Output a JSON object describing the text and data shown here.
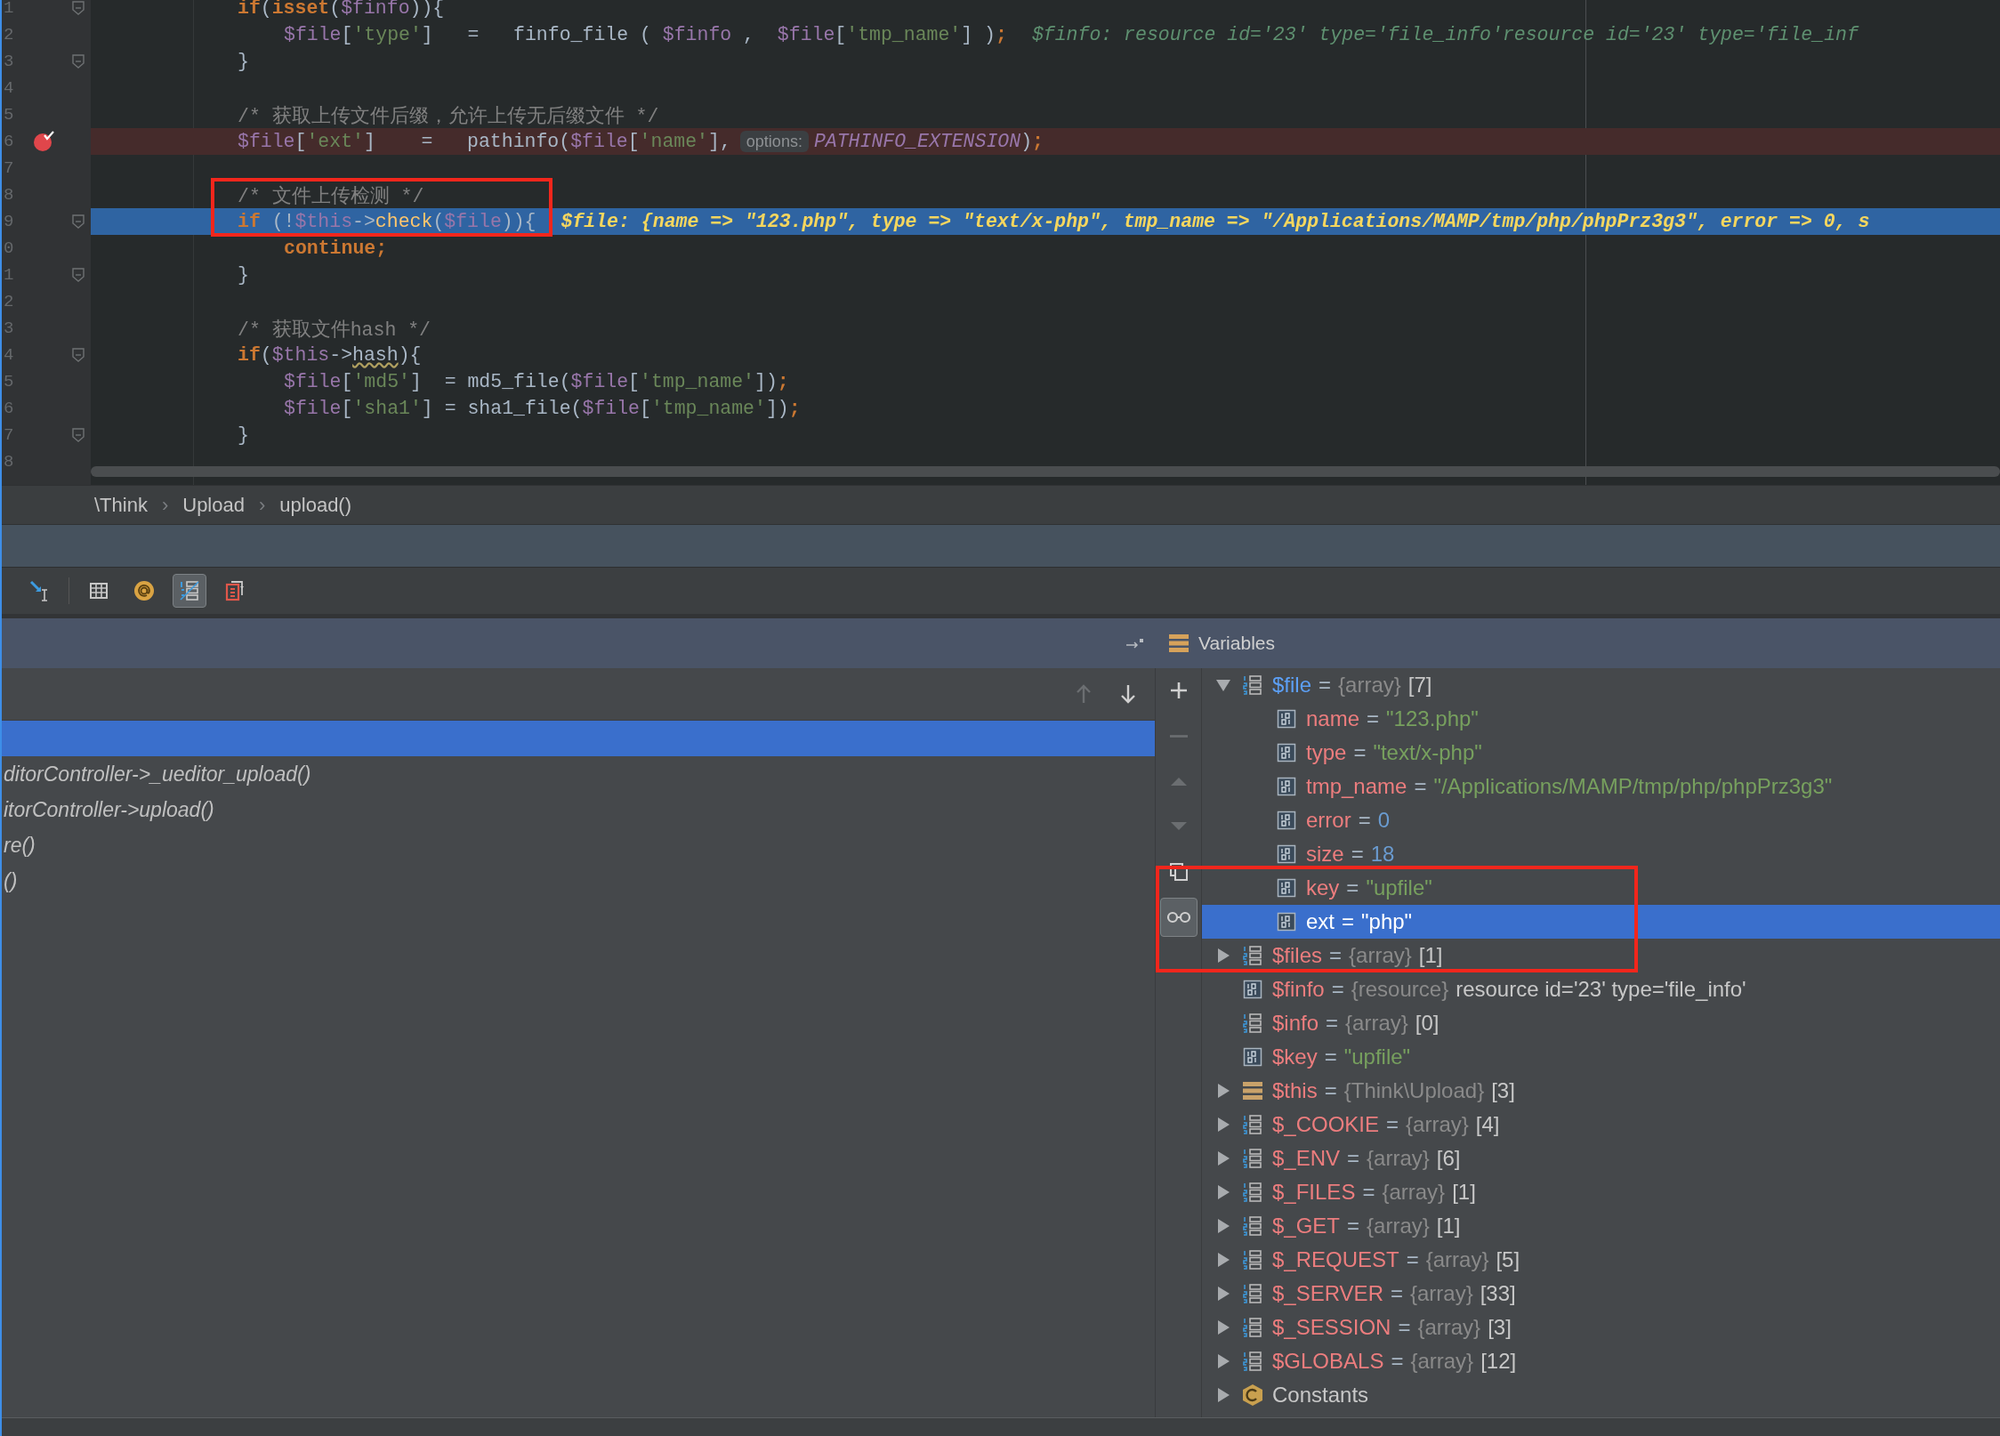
{
  "editor": {
    "lines": [
      {
        "number": "1",
        "kind": "normal",
        "fold": true,
        "segments": [
          {
            "kind": "code",
            "tokens": [
              {
                "kind": "kw",
                "text": "if"
              },
              {
                "kind": "plain",
                "text": "("
              },
              {
                "kind": "kw",
                "text": "isset"
              },
              {
                "kind": "plain",
                "text": "("
              },
              {
                "kind": "var",
                "text": "$finfo"
              },
              {
                "kind": "plain",
                "text": ")){"
              }
            ]
          }
        ],
        "children": [
          {
            "number": "2",
            "fold": false,
            "segments": [
              {
                "kind": "code",
                "tokens": [
                  {
                    "kind": "var",
                    "text": "$file"
                  },
                  {
                    "kind": "plain",
                    "text": "["
                  },
                  {
                    "kind": "str",
                    "text": "'type'"
                  },
                  {
                    "kind": "plain",
                    "text": "]   =   finfo_file ( "
                  },
                  {
                    "kind": "var",
                    "text": "$finfo"
                  },
                  {
                    "kind": "plain",
                    "text": " ,  "
                  },
                  {
                    "kind": "var",
                    "text": "$file"
                  },
                  {
                    "kind": "plain",
                    "text": "["
                  },
                  {
                    "kind": "str",
                    "text": "'tmp_name'"
                  },
                  {
                    "kind": "plain",
                    "text": "] )"
                  },
                  {
                    "kind": "kw",
                    "text": ";"
                  }
                ]
              },
              {
                "kind": "value-hint",
                "text": "$finfo: resource id='23' type='file_info'resource id='23' type='file_inf"
              }
            ]
          }
        ]
      },
      {
        "number": "3",
        "kind": "normal",
        "fold": true,
        "segments": [
          {
            "kind": "code",
            "tokens": [
              {
                "kind": "plain",
                "text": "}"
              }
            ]
          }
        ]
      },
      {
        "number": "4",
        "kind": "normal",
        "fold": false
      },
      {
        "number": "5",
        "kind": "normal",
        "fold": false,
        "segments": [
          {
            "kind": "code",
            "tokens": [
              {
                "kind": "comment",
                "text": "/* 获取上传文件后缀，允许上传无后缀文件 */"
              }
            ]
          }
        ]
      },
      {
        "number": "6",
        "kind": "breakpoint",
        "fold": false,
        "segments": [
          {
            "kind": "code",
            "tokens": [
              {
                "kind": "var",
                "text": "$file"
              },
              {
                "kind": "plain",
                "text": "["
              },
              {
                "kind": "str",
                "text": "'ext'"
              },
              {
                "kind": "plain",
                "text": "]    =   pathinfo("
              },
              {
                "kind": "var",
                "text": "$file"
              },
              {
                "kind": "plain",
                "text": "["
              },
              {
                "kind": "str",
                "text": "'name'"
              },
              {
                "kind": "plain",
                "text": "],"
              }
            ]
          },
          {
            "kind": "param-hint",
            "text": "options:"
          },
          {
            "kind": "code",
            "tokens": [
              {
                "kind": "const",
                "text": "PATHINFO_EXTENSION"
              },
              {
                "kind": "plain",
                "text": ")"
              },
              {
                "kind": "kw",
                "text": ";"
              }
            ]
          }
        ]
      },
      {
        "number": "7",
        "kind": "normal",
        "fold": false
      },
      {
        "number": "8",
        "kind": "normal",
        "fold": false,
        "outlined": true,
        "segments": [
          {
            "kind": "code",
            "tokens": [
              {
                "kind": "comment",
                "text": "/* 文件上传检测 */"
              }
            ]
          }
        ]
      },
      {
        "number": "9",
        "kind": "execution",
        "fold": true,
        "outlined": true,
        "segments": [
          {
            "kind": "code",
            "tokens": [
              {
                "kind": "kw",
                "text": "if"
              },
              {
                "kind": "plain",
                "text": " (!"
              },
              {
                "kind": "var",
                "text": "$this"
              },
              {
                "kind": "plain",
                "text": "->"
              },
              {
                "kind": "fn",
                "text": "check"
              },
              {
                "kind": "plain",
                "text": "("
              },
              {
                "kind": "var",
                "text": "$file"
              },
              {
                "kind": "plain",
                "text": ")){"
              }
            ]
          },
          {
            "kind": "value-hint",
            "text": "$file: {name => \"123.php\", type => \"text/x-php\", tmp_name => \"/Applications/MAMP/tmp/php/phpPrz3g3\", error => 0, s"
          }
        ],
        "children": [
          {
            "number": "0",
            "fold": false,
            "segments": [
              {
                "kind": "code",
                "tokens": [
                  {
                    "kind": "kw",
                    "text": "continue;"
                  }
                ]
              }
            ]
          }
        ]
      },
      {
        "number": "1",
        "kind": "normal",
        "fold": true,
        "segments": [
          {
            "kind": "code",
            "tokens": [
              {
                "kind": "plain",
                "text": "}"
              }
            ]
          }
        ]
      },
      {
        "number": "2",
        "kind": "normal",
        "fold": false
      },
      {
        "number": "3",
        "kind": "normal",
        "fold": false,
        "segments": [
          {
            "kind": "code",
            "tokens": [
              {
                "kind": "comment",
                "text": "/* 获取文件hash */"
              }
            ]
          }
        ]
      },
      {
        "number": "4",
        "kind": "normal",
        "fold": true,
        "segments": [
          {
            "kind": "code",
            "tokens": [
              {
                "kind": "kw",
                "text": "if"
              },
              {
                "kind": "plain",
                "text": "("
              },
              {
                "kind": "var",
                "text": "$this"
              },
              {
                "kind": "plain",
                "text": "->"
              },
              {
                "kind": "warn",
                "text": "hash"
              },
              {
                "kind": "plain",
                "text": "){"
              }
            ]
          }
        ],
        "children": [
          {
            "number": "5",
            "fold": false,
            "segments": [
              {
                "kind": "code",
                "tokens": [
                  {
                    "kind": "var",
                    "text": "$file"
                  },
                  {
                    "kind": "plain",
                    "text": "["
                  },
                  {
                    "kind": "str",
                    "text": "'md5'"
                  },
                  {
                    "kind": "plain",
                    "text": "]  = md5_file("
                  },
                  {
                    "kind": "var",
                    "text": "$file"
                  },
                  {
                    "kind": "plain",
                    "text": "["
                  },
                  {
                    "kind": "str",
                    "text": "'tmp_name'"
                  },
                  {
                    "kind": "plain",
                    "text": "])"
                  },
                  {
                    "kind": "kw",
                    "text": ";"
                  }
                ]
              }
            ]
          },
          {
            "number": "6",
            "fold": false,
            "segments": [
              {
                "kind": "code",
                "tokens": [
                  {
                    "kind": "var",
                    "text": "$file"
                  },
                  {
                    "kind": "plain",
                    "text": "["
                  },
                  {
                    "kind": "str",
                    "text": "'sha1'"
                  },
                  {
                    "kind": "plain",
                    "text": "] = sha1_file("
                  },
                  {
                    "kind": "var",
                    "text": "$file"
                  },
                  {
                    "kind": "plain",
                    "text": "["
                  },
                  {
                    "kind": "str",
                    "text": "'tmp_name'"
                  },
                  {
                    "kind": "plain",
                    "text": "])"
                  },
                  {
                    "kind": "kw",
                    "text": ";"
                  }
                ]
              }
            ]
          }
        ]
      },
      {
        "number": "7",
        "kind": "normal",
        "fold": true,
        "segments": [
          {
            "kind": "code",
            "tokens": [
              {
                "kind": "plain",
                "text": "}"
              }
            ]
          }
        ]
      },
      {
        "number": "8",
        "kind": "normal",
        "fold": false
      }
    ]
  },
  "breadcrumbs": [
    {
      "kind": "item",
      "text": "\\Think"
    },
    {
      "kind": "separator",
      "text": "›"
    },
    {
      "kind": "item",
      "text": "Upload"
    },
    {
      "kind": "separator",
      "text": "›"
    },
    {
      "kind": "item",
      "text": "upload()"
    }
  ],
  "toolbar": [
    {
      "kind": "run-to-cursor",
      "on": false
    },
    {
      "kind": "table",
      "on": false
    },
    {
      "kind": "at",
      "on": false
    },
    {
      "kind": "list",
      "on": true
    },
    {
      "kind": "clipboard",
      "on": false
    }
  ],
  "frames": {
    "nav": [
      {
        "kind": "up",
        "disabled": true
      },
      {
        "kind": "down",
        "disabled": false
      }
    ],
    "items": [
      {
        "selected": true
      },
      {
        "label": "ditorController->_ueditor_upload()",
        "selected": false
      },
      {
        "label": "itorController->upload()",
        "selected": false
      },
      {
        "label": "re()",
        "selected": false
      },
      {
        "label": "()",
        "selected": false
      }
    ]
  },
  "variables": {
    "title": "Variables",
    "tools": [
      {
        "kind": "add",
        "disabled": false,
        "on": false
      },
      {
        "kind": "remove",
        "disabled": true,
        "on": false
      },
      {
        "kind": "up",
        "disabled": true,
        "on": false
      },
      {
        "kind": "down",
        "disabled": true,
        "on": false
      },
      {
        "kind": "copy",
        "disabled": false,
        "on": false
      },
      {
        "kind": "watches",
        "disabled": false,
        "on": true
      }
    ],
    "tree": [
      {
        "kind": "array",
        "name": "$file",
        "separator": "=",
        "type": "{array}",
        "value": {
          "kind": "plain",
          "text": "[7]"
        },
        "expanded": true,
        "changed": true,
        "selected": false,
        "children": [
          {
            "kind": "scalar",
            "name": "name",
            "separator": "=",
            "value": {
              "kind": "string",
              "text": "\"123.php\""
            },
            "changed": false,
            "selected": false
          },
          {
            "kind": "scalar",
            "name": "type",
            "separator": "=",
            "value": {
              "kind": "string",
              "text": "\"text/x-php\""
            },
            "changed": false,
            "selected": false
          },
          {
            "kind": "scalar",
            "name": "tmp_name",
            "separator": "=",
            "value": {
              "kind": "string",
              "text": "\"/Applications/MAMP/tmp/php/phpPrz3g3\""
            },
            "changed": false,
            "selected": false
          },
          {
            "kind": "scalar",
            "name": "error",
            "separator": "=",
            "value": {
              "kind": "number",
              "text": "0"
            },
            "changed": false,
            "selected": false
          },
          {
            "kind": "scalar",
            "name": "size",
            "separator": "=",
            "value": {
              "kind": "number",
              "text": "18"
            },
            "changed": false,
            "selected": false
          },
          {
            "kind": "scalar",
            "name": "key",
            "separator": "=",
            "value": {
              "kind": "string",
              "text": "\"upfile\""
            },
            "changed": false,
            "selected": false,
            "outlined": true
          },
          {
            "kind": "scalar",
            "name": "ext",
            "separator": "=",
            "value": {
              "kind": "string",
              "text": "\"php\""
            },
            "changed": false,
            "selected": true,
            "outlined": true
          }
        ]
      },
      {
        "kind": "array",
        "name": "$files",
        "separator": "=",
        "type": "{array}",
        "value": {
          "kind": "plain",
          "text": "[1]"
        },
        "expanded": false,
        "changed": false,
        "selected": false,
        "outlined": true
      },
      {
        "kind": "scalar",
        "name": "$finfo",
        "separator": "=",
        "type": "{resource}",
        "value": {
          "kind": "plain",
          "text": "resource id='23' type='file_info'"
        },
        "changed": false,
        "selected": false
      },
      {
        "kind": "array",
        "name": "$info",
        "separator": "=",
        "type": "{array}",
        "value": {
          "kind": "plain",
          "text": "[0]"
        },
        "changed": false,
        "selected": false
      },
      {
        "kind": "scalar",
        "name": "$key",
        "separator": "=",
        "value": {
          "kind": "string",
          "text": "\"upfile\""
        },
        "changed": false,
        "selected": false
      },
      {
        "kind": "object",
        "name": "$this",
        "separator": "=",
        "type": "{Think\\Upload}",
        "value": {
          "kind": "plain",
          "text": "[3]"
        },
        "expanded": false,
        "changed": false,
        "selected": false
      },
      {
        "kind": "array",
        "name": "$_COOKIE",
        "separator": "=",
        "type": "{array}",
        "value": {
          "kind": "plain",
          "text": "[4]"
        },
        "expanded": false,
        "changed": false,
        "selected": false
      },
      {
        "kind": "array",
        "name": "$_ENV",
        "separator": "=",
        "type": "{array}",
        "value": {
          "kind": "plain",
          "text": "[6]"
        },
        "expanded": false,
        "changed": false,
        "selected": false
      },
      {
        "kind": "array",
        "name": "$_FILES",
        "separator": "=",
        "type": "{array}",
        "value": {
          "kind": "plain",
          "text": "[1]"
        },
        "expanded": false,
        "changed": false,
        "selected": false
      },
      {
        "kind": "array",
        "name": "$_GET",
        "separator": "=",
        "type": "{array}",
        "value": {
          "kind": "plain",
          "text": "[1]"
        },
        "expanded": false,
        "changed": false,
        "selected": false
      },
      {
        "kind": "array",
        "name": "$_REQUEST",
        "separator": "=",
        "type": "{array}",
        "value": {
          "kind": "plain",
          "text": "[5]"
        },
        "expanded": false,
        "changed": false,
        "selected": false
      },
      {
        "kind": "array",
        "name": "$_SERVER",
        "separator": "=",
        "type": "{array}",
        "value": {
          "kind": "plain",
          "text": "[33]"
        },
        "expanded": false,
        "changed": false,
        "selected": false
      },
      {
        "kind": "array",
        "name": "$_SESSION",
        "separator": "=",
        "type": "{array}",
        "value": {
          "kind": "plain",
          "text": "[3]"
        },
        "expanded": false,
        "changed": false,
        "selected": false
      },
      {
        "kind": "array",
        "name": "$GLOBALS",
        "separator": "=",
        "type": "{array}",
        "value": {
          "kind": "plain",
          "text": "[12]"
        },
        "expanded": false,
        "changed": false,
        "selected": false
      },
      {
        "kind": "constants",
        "name": "Constants",
        "expanded": false,
        "selected": false
      }
    ]
  }
}
